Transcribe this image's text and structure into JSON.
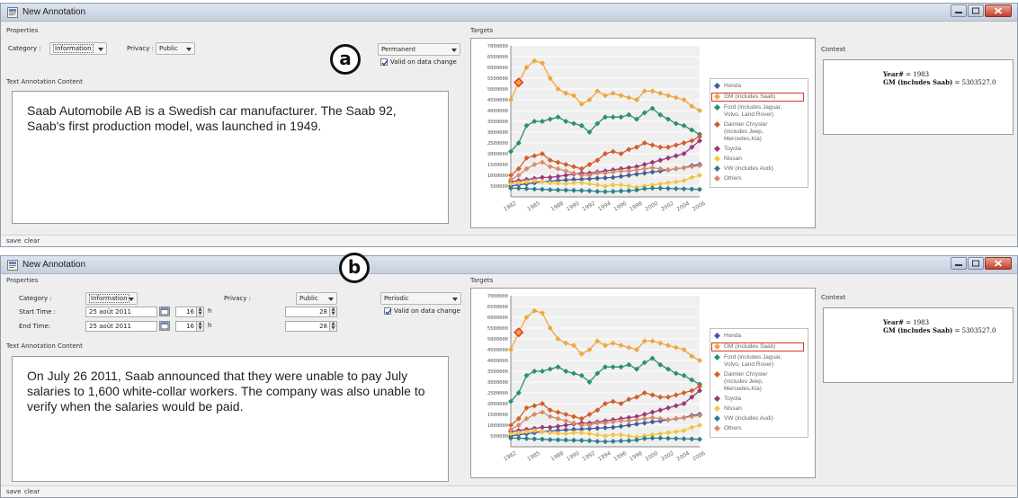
{
  "colors": {
    "Honda": "#3f5c9c",
    "GM": "#f0a63c",
    "Ford": "#2a8f6e",
    "Daimler": "#d35e2a",
    "Toyota": "#9b3878",
    "Nissan": "#f4c542",
    "VW": "#2f7f8c",
    "Others": "#d98a6a",
    "highlight": "#e23a2a"
  },
  "panel_a": {
    "window_title": "New Annotation",
    "callout": "a",
    "properties_label": "Properties",
    "category_label": "Category :",
    "category_value": "Information",
    "privacy_label": "Privacy :",
    "privacy_value": "Public",
    "duration_value": "Permanent",
    "valid_checkbox_label": "Valid on data change",
    "text_content_label": "Text Annotation Content",
    "annotation_text": "Saab Automobile AB  is a Swedish car manufacturer. The Saab 92, Saab's first production model, was launched in 1949.",
    "targets_label": "Targets",
    "context_label": "Context",
    "context_year_key": "Year#",
    "context_year_val": " = 1983",
    "context_gm_key": "GM (includes Saab)",
    "context_gm_val": " = 5303527.0",
    "save": "save",
    "clear": "clear"
  },
  "panel_b": {
    "window_title": "New Annotation",
    "callout": "b",
    "properties_label": "Properties",
    "category_label": "Category :",
    "category_value": "Information",
    "privacy_label": "Privacy :",
    "privacy_value": "Public",
    "duration_value": "Periodic",
    "valid_checkbox_label": "Valid on data change",
    "start_label": "Start Time :",
    "end_label": "End Time:",
    "start_date": "25 août 2011",
    "end_date": "25 août 2011",
    "start_hour": "16",
    "end_hour": "16",
    "hour_unit": "h",
    "start_min": "28",
    "end_min": "28",
    "text_content_label": "Text Annotation Content",
    "annotation_text": "On July 26 2011, Saab announced that they were unable to pay July salaries to 1,600 white-collar workers. The company was also unable to verify when the salaries would be paid.",
    "targets_label": "Targets",
    "context_label": "Context",
    "context_year_key": "Year#",
    "context_year_val": " = 1983",
    "context_gm_key": "GM (includes Saab)",
    "context_gm_val": " = 5303527.0",
    "save": "save",
    "clear": "clear"
  },
  "chart_data": {
    "type": "line",
    "x": [
      "1982",
      "1983",
      "1984",
      "1985",
      "1986",
      "1987",
      "1988",
      "1989",
      "1990",
      "1991",
      "1992",
      "1993",
      "1994",
      "1995",
      "1996",
      "1997",
      "1998",
      "1999",
      "2000",
      "2001",
      "2002",
      "2003",
      "2004",
      "2005",
      "2006"
    ],
    "x_tick_labels": [
      "1982",
      "1985",
      "1988",
      "1990",
      "1992",
      "1994",
      "1996",
      "1998",
      "2000",
      "2002",
      "2004",
      "2006"
    ],
    "y_ticks": [
      500000,
      1000000,
      1500000,
      2000000,
      2500000,
      3000000,
      3500000,
      4000000,
      4500000,
      5000000,
      5500000,
      6000000,
      6500000,
      7000000
    ],
    "ylim": [
      0,
      7000000
    ],
    "highlight": {
      "series": "GM (includes Saab)",
      "x": "1983",
      "y": 5303527
    },
    "series": [
      {
        "name": "Honda",
        "color_key": "Honda",
        "values": [
          500000,
          560000,
          600000,
          650000,
          700000,
          720000,
          760000,
          780000,
          800000,
          820000,
          840000,
          860000,
          880000,
          900000,
          950000,
          1000000,
          1050000,
          1100000,
          1150000,
          1200000,
          1250000,
          1300000,
          1350000,
          1450000,
          1500000
        ]
      },
      {
        "name": "GM (includes Saab)",
        "color_key": "GM",
        "values": [
          4500000,
          5303527,
          6000000,
          6300000,
          6200000,
          5500000,
          5000000,
          4800000,
          4700000,
          4300000,
          4500000,
          4900000,
          4700000,
          4800000,
          4700000,
          4600000,
          4500000,
          4900000,
          4900000,
          4800000,
          4700000,
          4600000,
          4500000,
          4200000,
          4000000
        ]
      },
      {
        "name": "Ford (includes Jaguar, Volvo, Land Rover)",
        "color_key": "Ford",
        "values": [
          2100000,
          2500000,
          3300000,
          3500000,
          3500000,
          3600000,
          3700000,
          3500000,
          3400000,
          3300000,
          3000000,
          3400000,
          3700000,
          3700000,
          3700000,
          3800000,
          3600000,
          3900000,
          4100000,
          3800000,
          3600000,
          3400000,
          3300000,
          3100000,
          2900000
        ]
      },
      {
        "name": "Daimler Chrysler (includes Jeep, Mercedes,Kia)",
        "color_key": "Daimler",
        "values": [
          1000000,
          1300000,
          1800000,
          1900000,
          2000000,
          1700000,
          1600000,
          1500000,
          1400000,
          1300000,
          1500000,
          1700000,
          2000000,
          2100000,
          2000000,
          2200000,
          2300000,
          2500000,
          2400000,
          2300000,
          2300000,
          2400000,
          2500000,
          2600000,
          2800000
        ]
      },
      {
        "name": "Toyota",
        "color_key": "Toyota",
        "values": [
          700000,
          750000,
          800000,
          850000,
          900000,
          900000,
          950000,
          1000000,
          1050000,
          1100000,
          1100000,
          1150000,
          1200000,
          1250000,
          1300000,
          1350000,
          1400000,
          1500000,
          1600000,
          1700000,
          1800000,
          1900000,
          2000000,
          2300000,
          2600000
        ]
      },
      {
        "name": "Nissan",
        "color_key": "Nissan",
        "values": [
          600000,
          650000,
          700000,
          750000,
          700000,
          650000,
          620000,
          600000,
          650000,
          650000,
          600000,
          550000,
          500000,
          550000,
          550000,
          500000,
          450000,
          500000,
          550000,
          600000,
          650000,
          700000,
          750000,
          900000,
          1000000
        ]
      },
      {
        "name": "VW (includes Audi)",
        "color_key": "VW",
        "values": [
          400000,
          400000,
          380000,
          360000,
          350000,
          330000,
          320000,
          310000,
          300000,
          290000,
          280000,
          250000,
          240000,
          250000,
          270000,
          280000,
          320000,
          380000,
          400000,
          400000,
          390000,
          380000,
          370000,
          360000,
          350000
        ]
      },
      {
        "name": "Others",
        "color_key": "Others",
        "values": [
          800000,
          1000000,
          1300000,
          1500000,
          1600000,
          1400000,
          1300000,
          1200000,
          1100000,
          1000000,
          1000000,
          1100000,
          1100000,
          1150000,
          1200000,
          1200000,
          1250000,
          1300000,
          1350000,
          1300000,
          1250000,
          1300000,
          1350000,
          1400000,
          1450000
        ]
      }
    ],
    "legend": {
      "placement": "right"
    }
  }
}
